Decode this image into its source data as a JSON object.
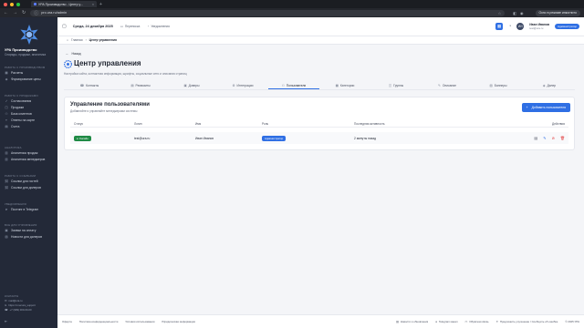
{
  "browser": {
    "tab_title": "УРА Производство - Центр у...",
    "url": "pro.ura.ru/admin",
    "update_label": "Окно в режиме инкогнито"
  },
  "sidebar": {
    "brand": "УРА Производство",
    "brand_sub": "Снаряды, продажи, аналитика",
    "sections": [
      {
        "title": "РАБОТА С ПРОИЗВОДСТВОМ",
        "items": [
          "Расчеты",
          "Формирование цены"
        ]
      },
      {
        "title": "РАБОТА С ПРОДАЖАМИ",
        "items": [
          "Согласования",
          "Продажи",
          "База клиентов",
          "Ответы на карте",
          "Счета"
        ]
      },
      {
        "title": "АНАЛИТИКА",
        "items": [
          "Аналитика продаж",
          "Аналитика менеджеров"
        ]
      },
      {
        "title": "РАБОТА С ССЫЛКАМИ",
        "items": [
          "Ссылки для гостей",
          "Ссылки для дилеров"
        ]
      },
      {
        "title": "УВЕДОМЛЕНИЯ",
        "items": [
          "Постинг в Telegram"
        ]
      },
      {
        "title": "ВСЕ ДЛЯ УПРАВЛЕНИЯ",
        "items": [
          "Заявки на оплату",
          "Новости для дилеров"
        ]
      }
    ],
    "contacts_title": "КОНТАКТЫ",
    "contacts": [
      "mail@ura.ru",
      "https://t.me/ura_support",
      "+7 (999) 000-00-00"
    ]
  },
  "header": {
    "date": "Среда, 24 декабря 2025",
    "links": [
      "Переписка",
      "Уведомления"
    ],
    "user_name": "Иван Иванов",
    "user_email": "test@ura.ru",
    "user_role": "Администратор",
    "avatar_initials": "ИИ"
  },
  "breadcrumb": {
    "home": "Главная",
    "current": "Центр управления"
  },
  "main": {
    "back_label": "Назад",
    "title": "Центр управления",
    "subtitle": "Настройки сайта, контактная информация, шрифты, социальные сети и описания страниц",
    "tabs": [
      {
        "label": "Контакты",
        "icon": "☎"
      },
      {
        "label": "Реквизиты",
        "icon": "▤"
      },
      {
        "label": "Доверы",
        "icon": "▣"
      },
      {
        "label": "Интеграции",
        "icon": "⚙"
      },
      {
        "label": "Пользователи",
        "icon": "⚇"
      },
      {
        "label": "Категории",
        "icon": "▦"
      },
      {
        "label": "Группы",
        "icon": "◫"
      },
      {
        "label": "Описание",
        "icon": "✎"
      },
      {
        "label": "Баннеры",
        "icon": "▧"
      },
      {
        "label": "Дилер",
        "icon": "◈"
      }
    ],
    "active_tab": 4
  },
  "users_card": {
    "title": "Управление пользователями",
    "subtitle": "Добавляйте и управляйте менеджерами системы",
    "add_label": "Добавить пользователя",
    "columns": [
      "Статус",
      "Логин",
      "Имя",
      "Роль",
      "Последняя активность",
      "Действия"
    ],
    "rows": [
      {
        "status": "Онлайн",
        "login": "test@ura.ru",
        "name": "Иван Иванов",
        "role": "Администратор",
        "last_active": "2 минуты назад"
      }
    ]
  },
  "footer": {
    "left_links": [
      "Оферта",
      "Политика конфиденциальности",
      "Условия использования",
      "Юридическая информация"
    ],
    "right_links": [
      "Новости и обновления",
      "Telegram канал",
      "Обратная связь",
      "Предложить улучшение / Сообщить об ошибке"
    ],
    "copyright": "© 2025 УРА"
  },
  "colors": {
    "accent": "#2f6fe4",
    "sidebar": "#232938",
    "online": "#1f8a45"
  }
}
